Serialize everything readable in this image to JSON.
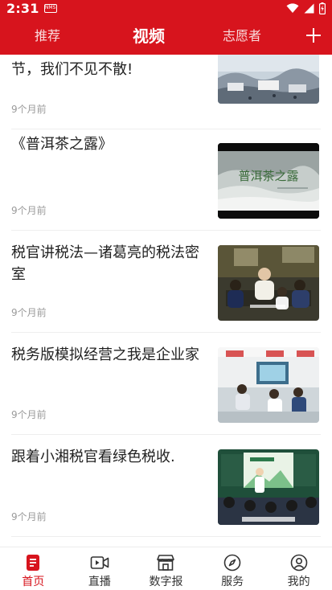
{
  "status_bar": {
    "time": "2:31",
    "notification_badge": "NMS"
  },
  "tabs": [
    {
      "label": "推荐",
      "active": false
    },
    {
      "label": "视频",
      "active": true
    },
    {
      "label": "志愿者",
      "active": false
    }
  ],
  "feed": [
    {
      "title": "节，我们不见不散!",
      "time": "9个月前"
    },
    {
      "title": "《普洱茶之露》",
      "time": "9个月前",
      "thumb_caption": "普洱茶之露"
    },
    {
      "title": "税官讲税法—诸葛亮的税法密室",
      "time": "9个月前"
    },
    {
      "title": "税务版模拟经营之我是企业家",
      "time": "9个月前"
    },
    {
      "title": "跟着小湘税官看绿色税收.",
      "time": "9个月前"
    }
  ],
  "bottom_nav": [
    {
      "label": "首页",
      "icon": "document-icon",
      "active": true
    },
    {
      "label": "直播",
      "icon": "video-camera-icon",
      "active": false
    },
    {
      "label": "数字报",
      "icon": "storefront-icon",
      "active": false
    },
    {
      "label": "服务",
      "icon": "compass-icon",
      "active": false
    },
    {
      "label": "我的",
      "icon": "user-circle-icon",
      "active": false
    }
  ],
  "colors": {
    "brand_red": "#d7141d",
    "text": "#222222",
    "muted": "#9a9a9a"
  }
}
